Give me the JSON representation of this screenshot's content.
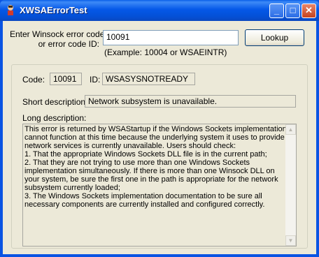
{
  "window": {
    "title": "XWSAErrorTest"
  },
  "titlebar": {
    "minimize": "_",
    "maximize": "□",
    "close": "✕"
  },
  "lookup": {
    "prompt_line1": "Enter Winsock error code,",
    "prompt_line2": "or error code ID:",
    "input_value": "10091",
    "example": "(Example:  10004 or WSAEINTR)",
    "button_label": "Lookup"
  },
  "result": {
    "code_label": "Code:",
    "code_value": "10091",
    "id_label": "ID:",
    "id_value": "WSASYSNOTREADY",
    "short_label": "Short description:",
    "short_value": "Network subsystem is unavailable.",
    "long_label": "Long description:",
    "long_lines": [
      "This error is returned by WSAStartup if the Windows Sockets implementation",
      "cannot function at this time because the underlying system it uses to provide",
      "network services is currently unavailable. Users should check:",
      "1. That the appropriate Windows Sockets DLL file is in the current path;",
      "2. That they are not trying to use more than one Windows Sockets",
      "implementation simultaneously. If there is more than one Winsock DLL on",
      "your system, be sure the first one in the path is appropriate for the network",
      "subsystem currently loaded;",
      "3. The Windows Sockets implementation documentation to be sure all",
      "necessary components are currently installed and configured correctly."
    ]
  },
  "icons": {
    "app": "app-icon",
    "scroll_up": "arrow-up-icon",
    "scroll_down": "arrow-down-icon"
  },
  "colors": {
    "titlebar": "#0558e8",
    "face": "#ece9d8",
    "close_button": "#c5421e"
  }
}
